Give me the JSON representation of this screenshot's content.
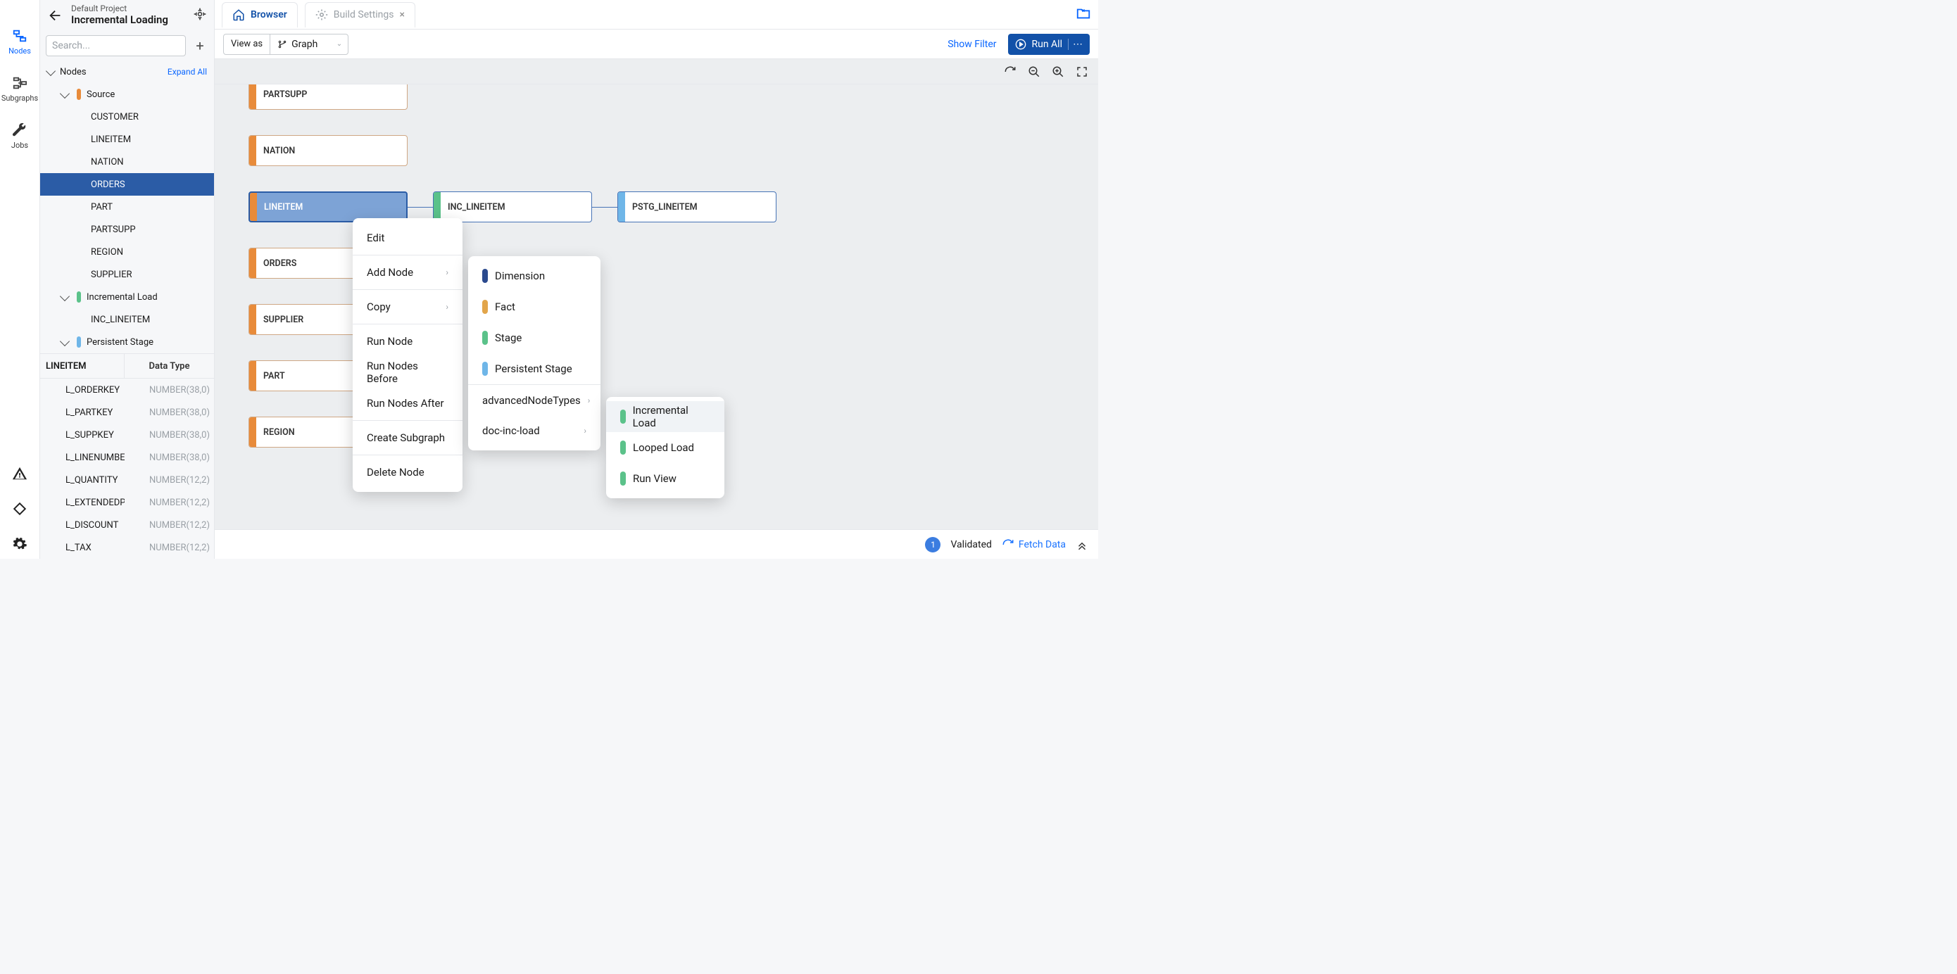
{
  "project": {
    "sub": "Default Project",
    "title": "Incremental Loading"
  },
  "navrail": {
    "nodes": "Nodes",
    "subgraphs": "Subgraphs",
    "jobs": "Jobs"
  },
  "sidebar": {
    "search_placeholder": "Search...",
    "tree_header": "Nodes",
    "expand_all": "Expand All",
    "groups": {
      "source": {
        "label": "Source",
        "items": [
          "CUSTOMER",
          "LINEITEM",
          "NATION",
          "ORDERS",
          "PART",
          "PARTSUPP",
          "REGION",
          "SUPPLIER"
        ]
      },
      "inc": {
        "label": "Incremental Load",
        "items": [
          "INC_LINEITEM"
        ]
      },
      "pstg": {
        "label": "Persistent Stage"
      }
    },
    "details": {
      "entity": "LINEITEM",
      "col_header": "Data Type",
      "cols": [
        {
          "n": "L_ORDERKEY",
          "t": "NUMBER(38,0)"
        },
        {
          "n": "L_PARTKEY",
          "t": "NUMBER(38,0)"
        },
        {
          "n": "L_SUPPKEY",
          "t": "NUMBER(38,0)"
        },
        {
          "n": "L_LINENUMBER",
          "t": "NUMBER(38,0)"
        },
        {
          "n": "L_QUANTITY",
          "t": "NUMBER(12,2)"
        },
        {
          "n": "L_EXTENDEDPRICE",
          "t": "NUMBER(12,2)"
        },
        {
          "n": "L_DISCOUNT",
          "t": "NUMBER(12,2)"
        },
        {
          "n": "L_TAX",
          "t": "NUMBER(12,2)"
        }
      ]
    }
  },
  "tabs": {
    "browser": "Browser",
    "build": "Build Settings"
  },
  "toolbar": {
    "view_as": "View as",
    "graph": "Graph",
    "show_filter": "Show Filter",
    "run_all": "Run All"
  },
  "graph": {
    "nodes": {
      "partsupp": "PARTSUPP",
      "nation": "NATION",
      "lineitem": "LINEITEM",
      "inc_lineitem": "INC_LINEITEM",
      "pstg_lineitem": "PSTG_LINEITEM",
      "orders": "ORDERS",
      "supplier": "SUPPLIER",
      "part": "PART",
      "region": "REGION"
    }
  },
  "ctx1": {
    "edit": "Edit",
    "add_node": "Add Node",
    "copy": "Copy",
    "run_node": "Run Node",
    "run_before": "Run Nodes Before",
    "run_after": "Run Nodes After",
    "create_sub": "Create Subgraph",
    "delete": "Delete Node"
  },
  "ctx2": {
    "dim": "Dimension",
    "fact": "Fact",
    "stage": "Stage",
    "pstg": "Persistent Stage",
    "adv": "advancedNodeTypes",
    "doc": "doc-inc-load"
  },
  "ctx3": {
    "inc": "Incremental Load",
    "loop": "Looped Load",
    "rv": "Run View"
  },
  "status": {
    "count": "1",
    "validated": "Validated",
    "fetch": "Fetch Data"
  }
}
